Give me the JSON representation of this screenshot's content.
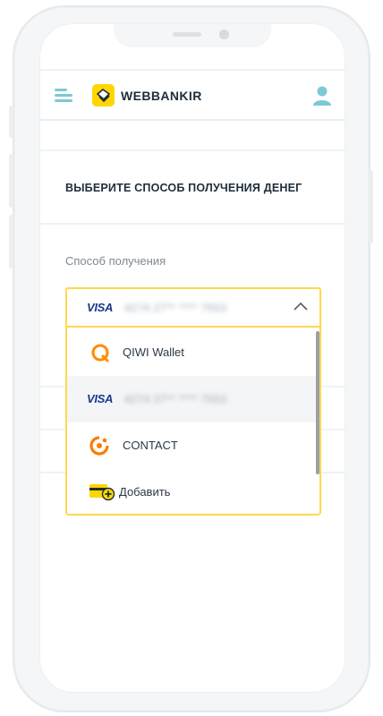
{
  "header": {
    "brand": "WEBBANKIR"
  },
  "page": {
    "title": "ВЫБЕРИТЕ СПОСОБ ПОЛУЧЕНИЯ ДЕНЕГ",
    "field_label": "Способ получения"
  },
  "select": {
    "card_brand": "VISA",
    "card_number": "4274 27** **** 7553"
  },
  "options": [
    {
      "label": "QIWI Wallet",
      "icon": "qiwi-icon"
    },
    {
      "card_brand": "VISA",
      "card_number": "4274 27** **** 7553",
      "icon": "visa-icon",
      "selected": true
    },
    {
      "label": "CONTACT",
      "icon": "contact-icon"
    },
    {
      "label": "Добавить",
      "icon": "add-card-icon"
    }
  ],
  "colors": {
    "accent_yellow": "#ffd600",
    "field_border": "#ffd84d",
    "brand_text": "#1f2d3a",
    "menu_teal": "#7cc9d6",
    "qiwi_orange": "#ff8c00",
    "visa_blue": "#1a3a8c"
  }
}
